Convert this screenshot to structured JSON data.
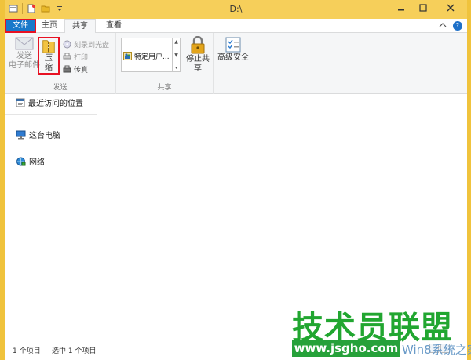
{
  "window": {
    "title": "D:\\",
    "controls": [
      "minimize-icon",
      "maximize-icon",
      "close-icon"
    ]
  },
  "quick_access": [
    "properties-icon",
    "new-folder-icon",
    "dropdown-icon"
  ],
  "ribbon_tabs": [
    {
      "label": "文件",
      "active": false,
      "highlighted": true
    },
    {
      "label": "主页",
      "active": false
    },
    {
      "label": "共享",
      "active": true
    },
    {
      "label": "查看",
      "active": false
    }
  ],
  "ribbon": {
    "send_group": {
      "label": "发送",
      "send_email": "发送\n电子邮件",
      "compress": "压\n缩",
      "burn": "刻录到光盘",
      "print": "打印",
      "fax": "传真"
    },
    "share_group": {
      "label": "共享",
      "specific_users": "特定用户...",
      "stop_sharing": "停止共享"
    },
    "security": {
      "advanced": "高级安全"
    }
  },
  "nav": {
    "recent": "最近访问的位置",
    "this_pc": "这台电脑",
    "network": "网络"
  },
  "status": {
    "item_count": "1 个项目",
    "selected": "选中 1 个项目"
  },
  "watermark": {
    "title": "技术员联盟",
    "url": "www.jsgho.com",
    "sub": "Win8系统之家"
  },
  "colors": {
    "file_tab": "#1979ca",
    "highlight_box": "#e81123",
    "title_bar": "#f6cf5a",
    "watermark_green": "#21a630"
  }
}
